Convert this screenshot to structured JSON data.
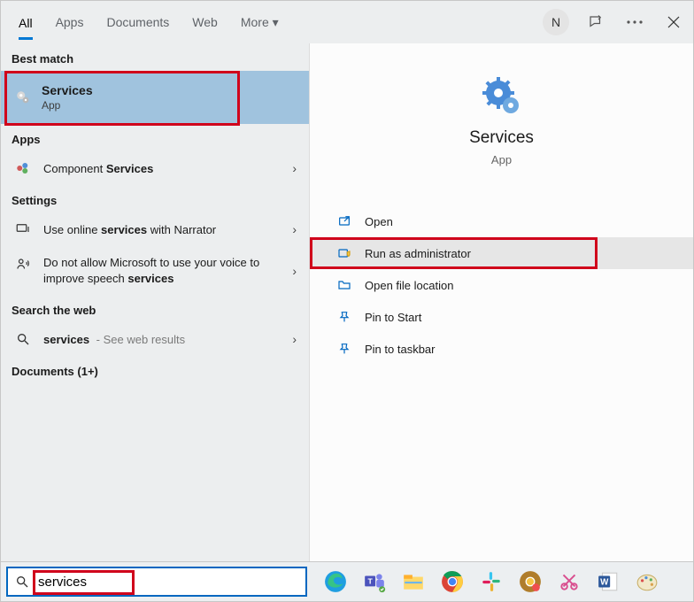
{
  "header": {
    "tabs": [
      "All",
      "Apps",
      "Documents",
      "Web",
      "More ▾"
    ],
    "avatar": "N"
  },
  "left": {
    "best_match_label": "Best match",
    "best_match": {
      "title": "Services",
      "sub": "App"
    },
    "apps_label": "Apps",
    "apps_item_prefix": "Component ",
    "apps_item_bold": "Services",
    "settings_label": "Settings",
    "setting1_pre": "Use online ",
    "setting1_bold": "services",
    "setting1_post": " with Narrator",
    "setting2_pre": "Do not allow Microsoft to use your voice to improve speech ",
    "setting2_bold": "services",
    "web_label": "Search the web",
    "web_item_bold": "services",
    "web_item_tail": " - See web results",
    "docs_label": "Documents (1+)"
  },
  "right": {
    "title": "Services",
    "sub": "App",
    "actions": [
      "Open",
      "Run as administrator",
      "Open file location",
      "Pin to Start",
      "Pin to taskbar"
    ]
  },
  "search": {
    "value": "services"
  }
}
